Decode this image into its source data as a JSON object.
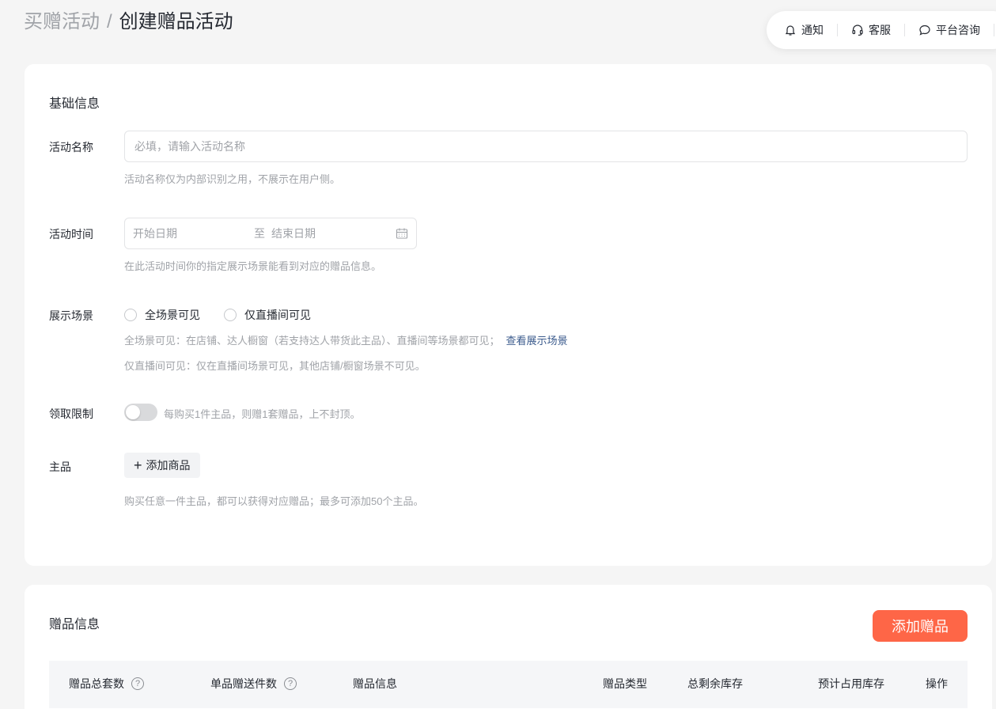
{
  "breadcrumb": {
    "parent": "买赠活动",
    "separator": "/",
    "current": "创建赠品活动"
  },
  "topbar": {
    "notify": "通知",
    "service": "客服",
    "consult": "平台咨询"
  },
  "basic": {
    "title": "基础信息",
    "name": {
      "label": "活动名称",
      "placeholder": "必填，请输入活动名称",
      "value": "",
      "help": "活动名称仅为内部识别之用，不展示在用户侧。"
    },
    "time": {
      "label": "活动时间",
      "start_placeholder": "开始日期",
      "to": "至",
      "end_placeholder": "结束日期",
      "help": "在此活动时间你的指定展示场景能看到对应的赠品信息。"
    },
    "scene": {
      "label": "展示场景",
      "options": [
        "全场景可见",
        "仅直播间可见"
      ],
      "help1": "全场景可见：在店铺、达人橱窗（若支持达人带货此主品）、直播间等场景都可见；",
      "help1_link": "查看展示场景",
      "help2": "仅直播间可见：仅在直播间场景可见，其他店铺/橱窗场景不可见。"
    },
    "limit": {
      "label": "领取限制",
      "enabled": false,
      "text": "每购买1件主品，则赠1套赠品，上不封顶。"
    },
    "main_product": {
      "label": "主品",
      "add_label": "添加商品",
      "help": "购买任意一件主品，都可以获得对应赠品；最多可添加50个主品。"
    }
  },
  "gift": {
    "title": "赠品信息",
    "add_label": "添加赠品",
    "columns": [
      "赠品总套数",
      "单品赠送件数",
      "赠品信息",
      "赠品类型",
      "总剩余库存",
      "预计占用库存",
      "操作"
    ]
  },
  "colors": {
    "accent": "#fe6647",
    "link": "#3a5a8c"
  }
}
